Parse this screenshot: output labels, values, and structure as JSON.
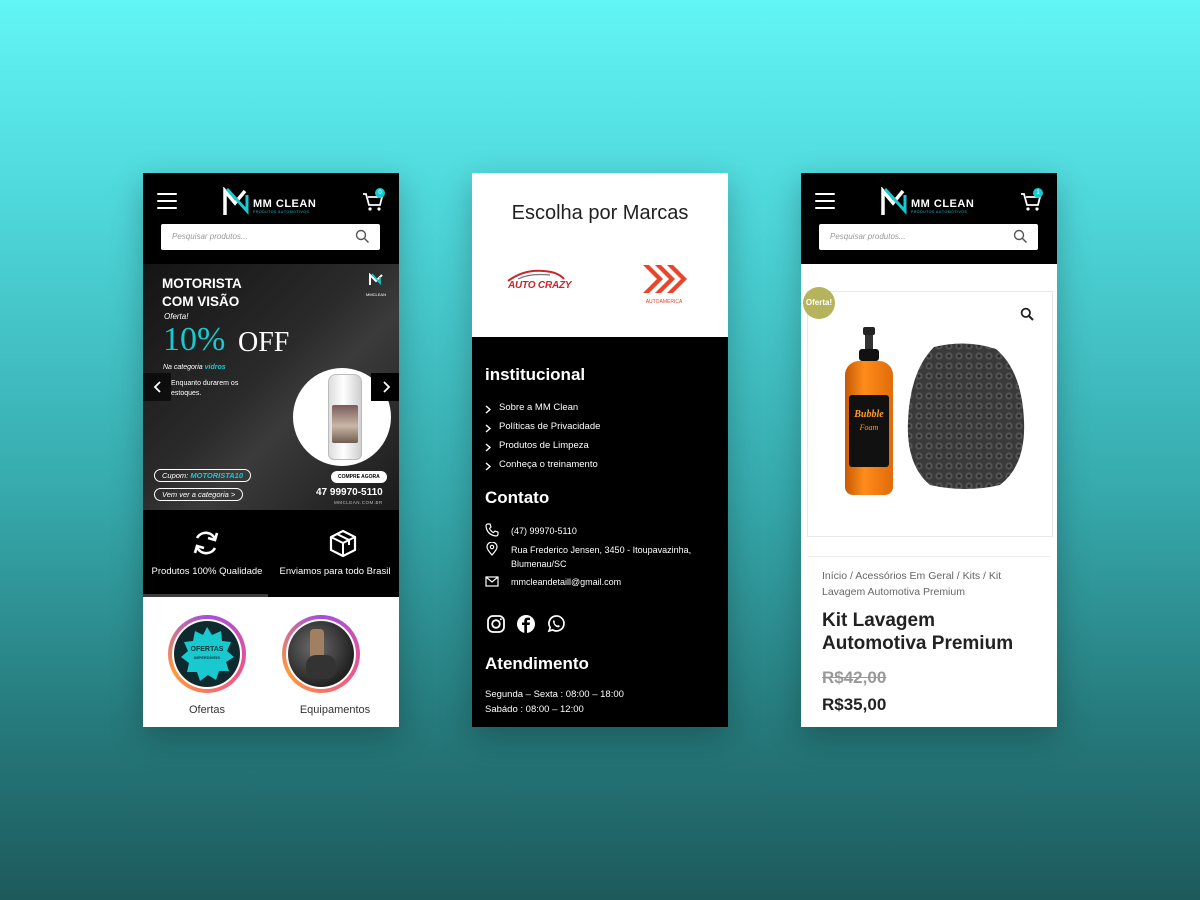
{
  "colors": {
    "accent": "#19c9cf",
    "dark": "#000000",
    "brand_red": "#c9252c"
  },
  "header": {
    "logo_text": "MM CLEAN",
    "logo_sub": "PRODUTOS AUTOMOTIVOS",
    "search_placeholder": "Pesquisar produtos...",
    "cart_count_left": "0",
    "cart_count_right": "1"
  },
  "banner": {
    "title_line1": "MOTORISTA",
    "title_line2": "COM VISÃO",
    "oferta": "Oferta!",
    "percent": "10%",
    "off": "OFF",
    "category_prefix": "Na categoria ",
    "category_name": "vidros",
    "while_text": "Enquanto durarem os estoques.",
    "logo_text": "MMCLEAN",
    "coupon_prefix": "Cupom: ",
    "coupon_code": "MOTORISTA10",
    "see_category": "Vem ver a categoria >",
    "buy_now": "COMPRE AGORA",
    "phone": "47 99970-5110",
    "site": "MMCLEAN.COM.BR"
  },
  "features": [
    {
      "label": "Produtos 100% Qualidade",
      "icon": "refresh-icon"
    },
    {
      "label": "Enviamos para todo Brasil",
      "icon": "box-icon"
    }
  ],
  "categories": [
    {
      "label": "Ofertas",
      "badge_line1": "OFERTAS",
      "badge_line2": "IMPERDÍVEIS"
    },
    {
      "label": "Equipamentos"
    }
  ],
  "brands": {
    "title": "Escolha por Marcas",
    "items": [
      {
        "name": "AUTO CRAZY"
      },
      {
        "name": "AUTOAMERICA"
      }
    ]
  },
  "institucional": {
    "title": "institucional",
    "links": [
      "Sobre a MM Clean",
      "Políticas de Privacidade",
      "Produtos de Limpeza",
      "Conheça o treinamento"
    ]
  },
  "contato": {
    "title": "Contato",
    "phone": "(47) 99970-5110",
    "address_line1": "Rua Frederico Jensen, 3450 - Itoupavazinha,",
    "address_line2": "Blumenau/SC",
    "email": "mmcleandetaill@gmail.com"
  },
  "social": [
    "instagram-icon",
    "facebook-icon",
    "whatsapp-icon"
  ],
  "atendimento": {
    "title": "Atendimento",
    "line1": "Segunda – Sexta : 08:00 – 18:00",
    "line2": "Sabádo : 08:00 – 12:00"
  },
  "product": {
    "badge": "Oferta!",
    "bottle_label_line1": "Bubble",
    "bottle_label_line2": "Foam",
    "breadcrumb": "Início / Acessórios Em Geral / Kits / Kit Lavagem Automotiva Premium",
    "title": "Kit Lavagem Automotiva Premium",
    "old_price": "R$42,00",
    "new_price": "R$35,00"
  }
}
